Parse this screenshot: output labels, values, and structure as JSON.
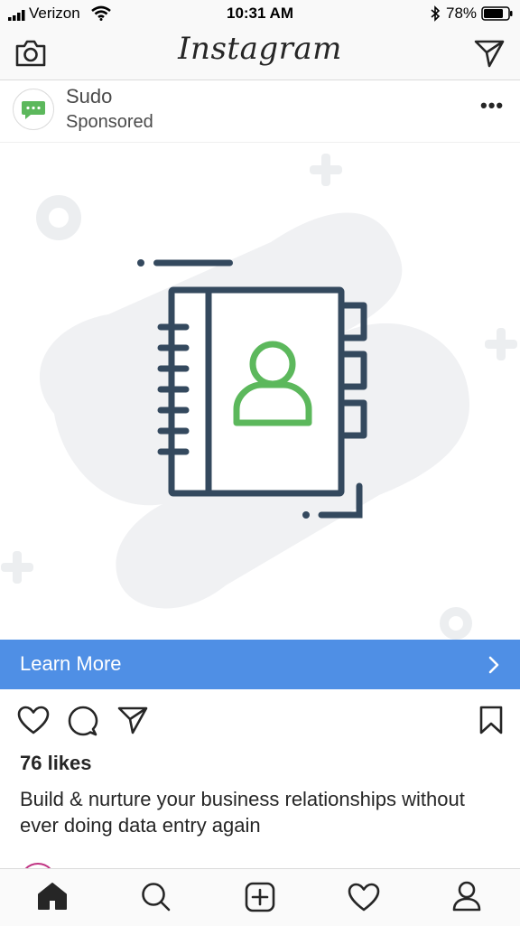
{
  "status_bar": {
    "carrier": "Verizon",
    "time": "10:31 AM",
    "battery": "78%"
  },
  "nav": {
    "title": "Instagram",
    "left_icon": "camera-icon",
    "right_icon": "direct-message-icon"
  },
  "post": {
    "username": "Sudo",
    "subtitle": "Sponsored",
    "more": "•••",
    "cta_label": "Learn More",
    "cta_chevron": "›",
    "likes": "76 likes",
    "caption": "Build & nurture your business relationships without ever doing data entry again",
    "image_icon": "address-book-icon"
  },
  "colors": {
    "cta": "#4f8fe5",
    "brand_green": "#5cb85c",
    "icon_dark": "#34495e",
    "blob": "#f0f1f3"
  },
  "tabs": [
    {
      "name": "home-tab",
      "icon": "home-icon",
      "active": true
    },
    {
      "name": "search-tab",
      "icon": "search-icon",
      "active": false
    },
    {
      "name": "add-tab",
      "icon": "add-post-icon",
      "active": false
    },
    {
      "name": "activity-tab",
      "icon": "heart-icon",
      "active": false
    },
    {
      "name": "profile-tab",
      "icon": "profile-icon",
      "active": false
    }
  ]
}
